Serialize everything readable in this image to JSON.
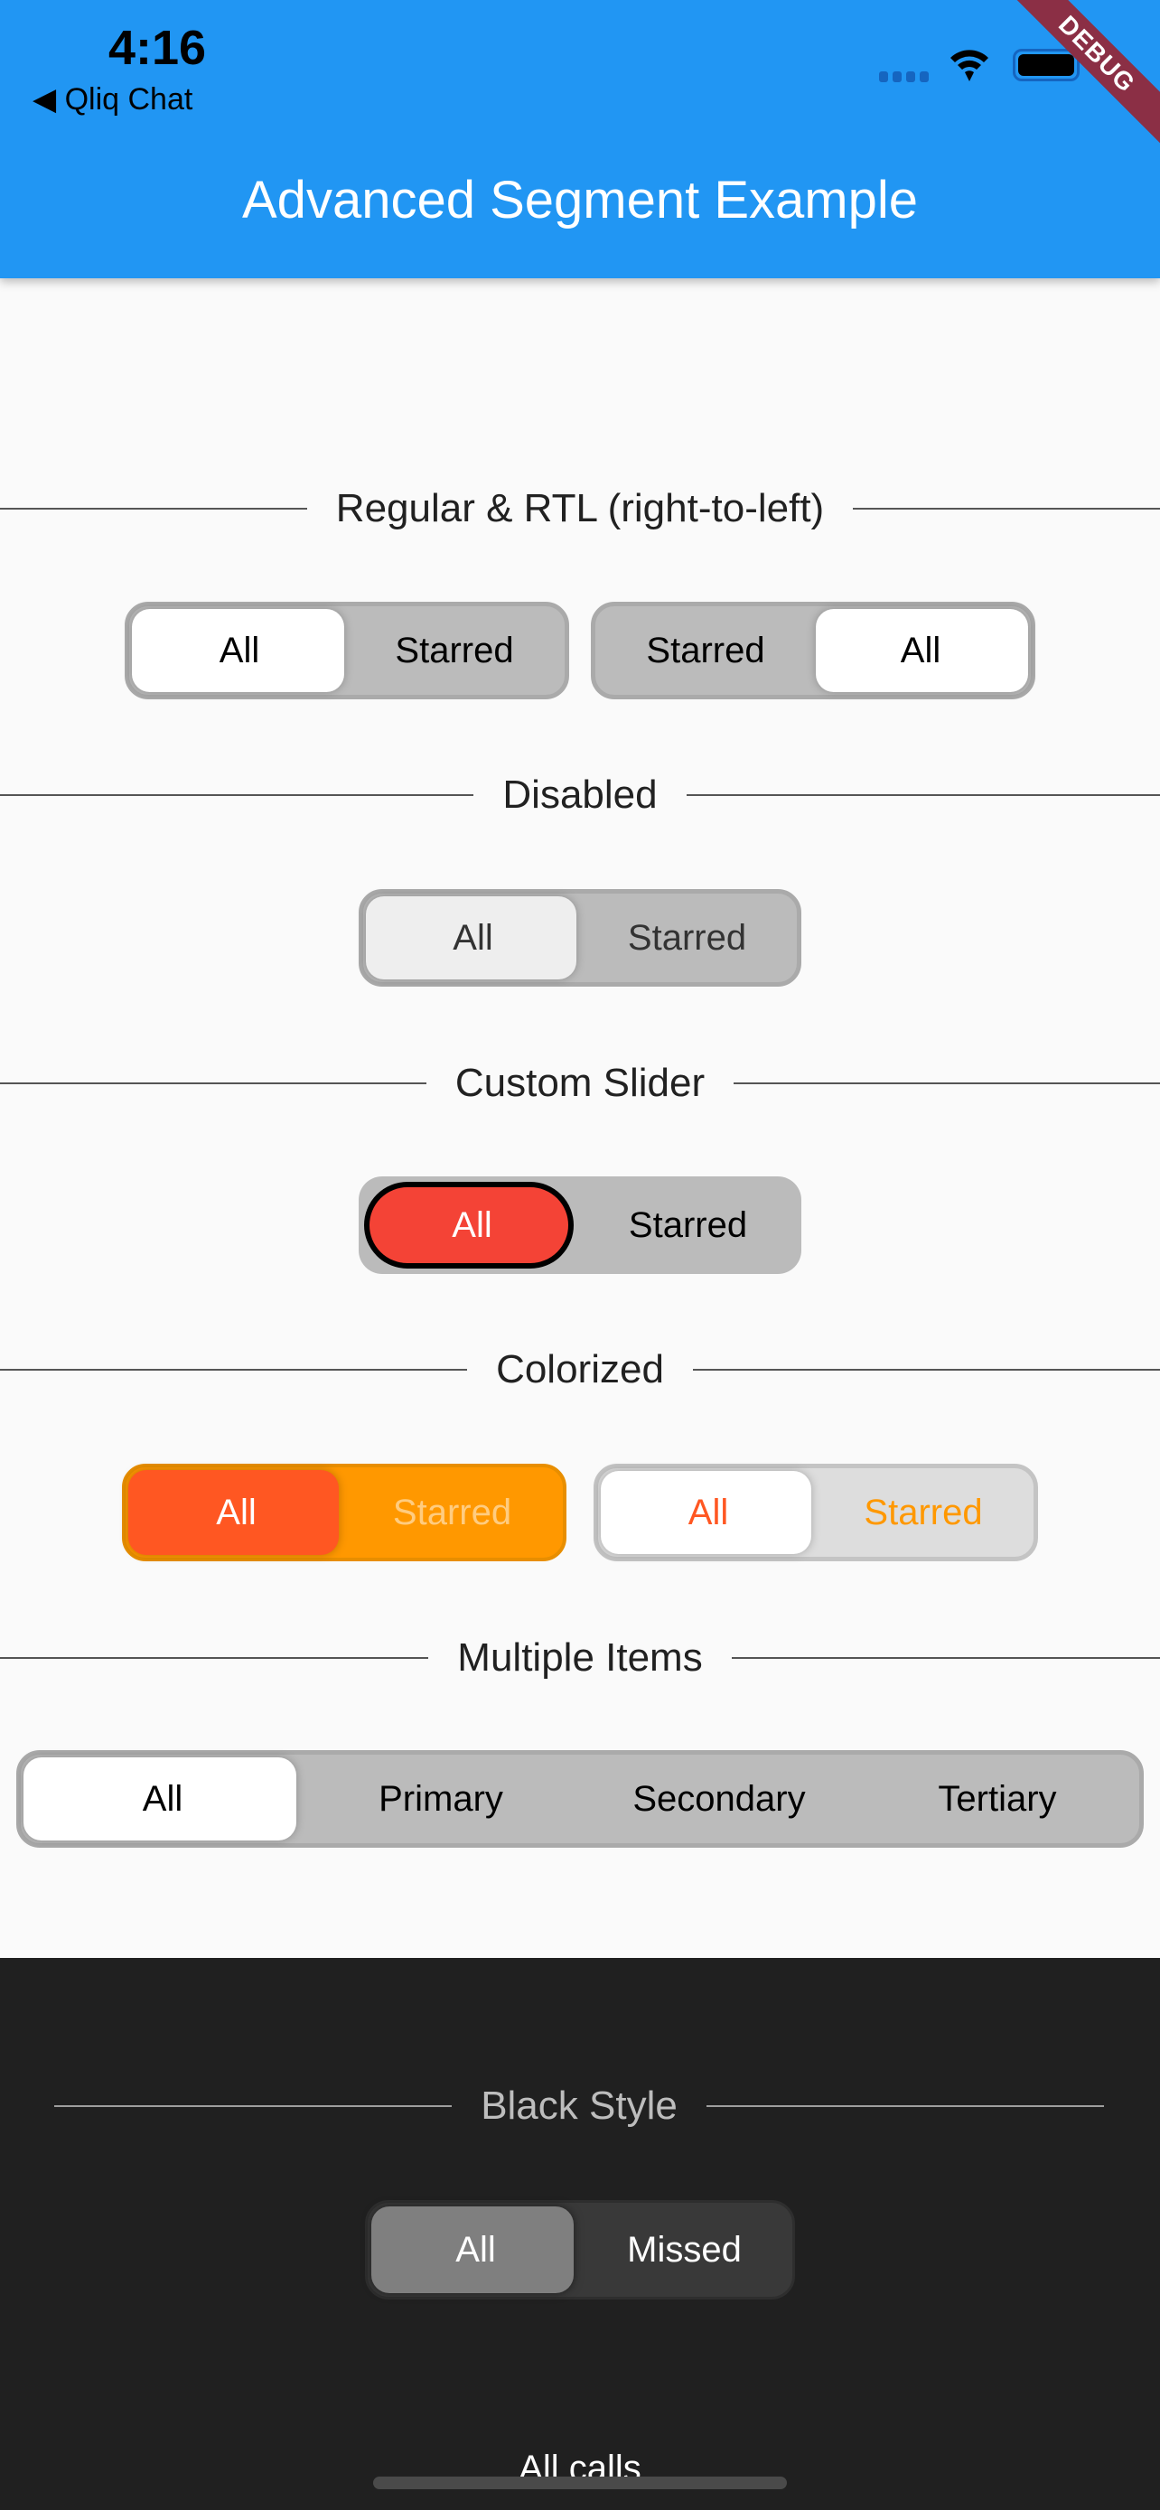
{
  "status_bar": {
    "time": "4:16",
    "back_app": "Qliq Chat",
    "icons": [
      "signal-icon",
      "wifi-icon",
      "battery-icon"
    ]
  },
  "app_bar": {
    "title": "Advanced Segment Example",
    "banner": "DEBUG",
    "color": "#2196F3"
  },
  "sections": {
    "regular": {
      "label": "Regular & RTL (right-to-left)",
      "ltr": [
        "All",
        "Starred"
      ],
      "rtl": [
        "Starred",
        "All"
      ],
      "selected": "All"
    },
    "disabled": {
      "label": "Disabled",
      "items": [
        "All",
        "Starred"
      ],
      "selected": "All"
    },
    "custom": {
      "label": "Custom Slider",
      "items": [
        "All",
        "Starred"
      ],
      "selected": "All",
      "thumb_color": "#F44336"
    },
    "colorized": {
      "label": "Colorized",
      "a": [
        "All",
        "Starred"
      ],
      "b": [
        "All",
        "Starred"
      ],
      "selected": "All",
      "colors": {
        "primary": "#FF5722",
        "secondary": "#FF9800"
      }
    },
    "multiple": {
      "label": "Multiple Items",
      "items": [
        "All",
        "Primary",
        "Secondary",
        "Tertiary"
      ],
      "selected": "All"
    },
    "black": {
      "label": "Black Style",
      "items": [
        "All",
        "Missed"
      ],
      "selected": "All",
      "caption": "All calls"
    }
  }
}
